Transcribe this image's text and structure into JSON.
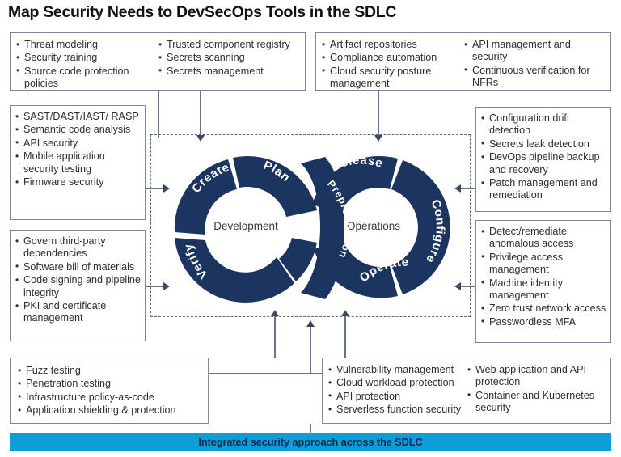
{
  "title": "Map Security Needs to DevSecOps Tools in the SDLC",
  "banner": {
    "text": "Integrated security approach across the SDLC"
  },
  "diagram": {
    "left_hub": "Development",
    "right_hub": "Operations",
    "left_segments": [
      "Create",
      "Plan",
      "Verify"
    ],
    "right_segments": [
      "Release",
      "Configure",
      "Operate"
    ],
    "bridge_segment": "Preproduction",
    "loop_color": "#1c3560",
    "boundary_style": "dashed"
  },
  "panels": {
    "top_left": {
      "col1": [
        "Threat modeling",
        "Security training",
        "Source code protection policies"
      ],
      "col2": [
        "Trusted component registry",
        "Secrets scanning",
        "Secrets management"
      ]
    },
    "top_right": {
      "col1": [
        "Artifact repositories",
        "Compliance automation",
        "Cloud security posture management"
      ],
      "col2": [
        "API management and security",
        "Continuous verification for NFRs"
      ]
    },
    "mid_left": {
      "col1": [
        "SAST/DAST/IAST/ RASP",
        "Semantic code analysis",
        "API security",
        "Mobile application security testing",
        "Firmware security"
      ]
    },
    "bottom_left_side": {
      "col1": [
        "Govern third-party dependencies",
        "Software bill of materials",
        "Code signing and pipeline integrity",
        "PKI and certificate management"
      ]
    },
    "mid_right": {
      "col1": [
        "Configuration drift detection",
        "Secrets leak detection",
        "DevOps pipeline backup and recovery",
        "Patch management and remediation"
      ]
    },
    "bottom_right_side": {
      "col1": [
        "Detect/remediate anomalous access",
        "Privilege access management",
        "Machine identity management",
        "Zero trust network access",
        "Passwordless MFA"
      ]
    },
    "bottom_left": {
      "col1": [
        "Fuzz testing",
        "Penetration testing",
        "Infrastructure policy-as-code",
        "Application shielding & protection"
      ]
    },
    "bottom_right": {
      "col1": [
        "Vulnerability management",
        "Cloud workload protection",
        "API protection",
        "Serverless function security"
      ],
      "col2": [
        "Web application and API protection",
        "Container and Kubernetes security"
      ]
    }
  }
}
